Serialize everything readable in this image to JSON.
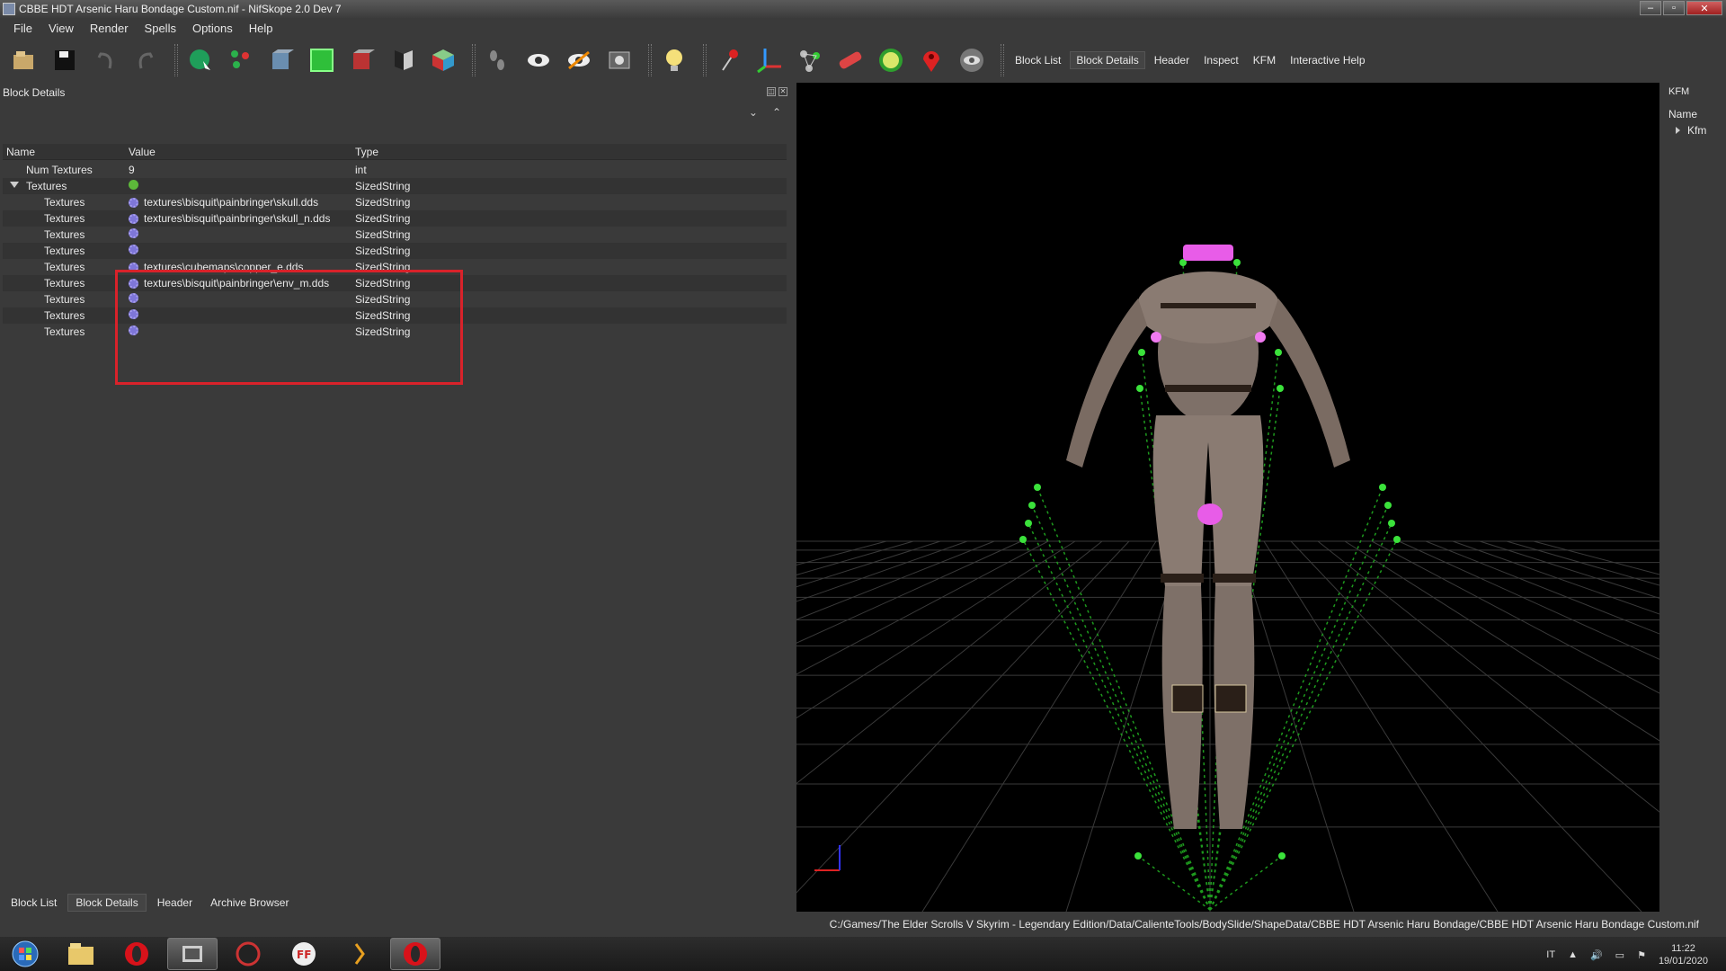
{
  "window": {
    "title": "CBBE HDT Arsenic Haru Bondage Custom.nif - NifSkope 2.0 Dev 7"
  },
  "menu": [
    "File",
    "View",
    "Render",
    "Spells",
    "Options",
    "Help"
  ],
  "toolbar": {
    "icons": [
      "load-icon",
      "save-icon",
      "undo-icon",
      "redo-icon",
      "select-object-icon",
      "select-vertex-icon",
      "view-front-icon",
      "view-top-icon",
      "view-side-icon",
      "view-flip-icon",
      "view-perspective-icon",
      "walk-icon",
      "show-hidden-icon",
      "show-nodes-icon",
      "screenshot-icon",
      "lighting-icon",
      "show-markers-icon",
      "show-axes-icon",
      "show-constraints-icon",
      "show-havok-icon",
      "show-furniture-icon",
      "show-marker-icon",
      "show-hidden-toggle-icon"
    ],
    "links": [
      "Block List",
      "Block Details",
      "Header",
      "Inspect",
      "KFM",
      "Interactive Help"
    ]
  },
  "block_details": {
    "panel_title": "Block Details",
    "columns": {
      "name": "Name",
      "value": "Value",
      "type": "Type"
    },
    "rows": [
      {
        "name": "Num Textures",
        "value": "9",
        "type": "int",
        "indent": 0
      },
      {
        "name": "Textures",
        "value": "",
        "type": "SizedString",
        "indent": 0
      },
      {
        "name": "Textures",
        "value": "textures\\bisquit\\painbringer\\skull.dds",
        "type": "SizedString",
        "indent": 1
      },
      {
        "name": "Textures",
        "value": "textures\\bisquit\\painbringer\\skull_n.dds",
        "type": "SizedString",
        "indent": 1
      },
      {
        "name": "Textures",
        "value": "",
        "type": "SizedString",
        "indent": 1
      },
      {
        "name": "Textures",
        "value": "",
        "type": "SizedString",
        "indent": 1
      },
      {
        "name": "Textures",
        "value": "textures\\cubemaps\\copper_e.dds",
        "type": "SizedString",
        "indent": 1
      },
      {
        "name": "Textures",
        "value": "textures\\bisquit\\painbringer\\env_m.dds",
        "type": "SizedString",
        "indent": 1
      },
      {
        "name": "Textures",
        "value": "",
        "type": "SizedString",
        "indent": 1
      },
      {
        "name": "Textures",
        "value": "",
        "type": "SizedString",
        "indent": 1
      },
      {
        "name": "Textures",
        "value": "",
        "type": "SizedString",
        "indent": 1
      }
    ]
  },
  "bottom_tabs": [
    "Block List",
    "Block Details",
    "Header",
    "Archive Browser"
  ],
  "kfm_panel": {
    "title": "KFM",
    "column": "Name",
    "item": "Kfm"
  },
  "status": {
    "path": "C:/Games/The Elder Scrolls V Skyrim - Legendary Edition/Data/CalienteTools/BodySlide/ShapeData/CBBE HDT Arsenic Haru Bondage/CBBE HDT Arsenic Haru Bondage Custom.nif"
  },
  "taskbar": {
    "apps": [
      "start-orb-icon",
      "explorer-icon",
      "opera-icon",
      "nifskope-icon",
      "game-icon",
      "ffdec-icon",
      "script-icon",
      "opera-active-icon"
    ],
    "language": "IT",
    "time": "11:22",
    "date": "19/01/2020"
  }
}
